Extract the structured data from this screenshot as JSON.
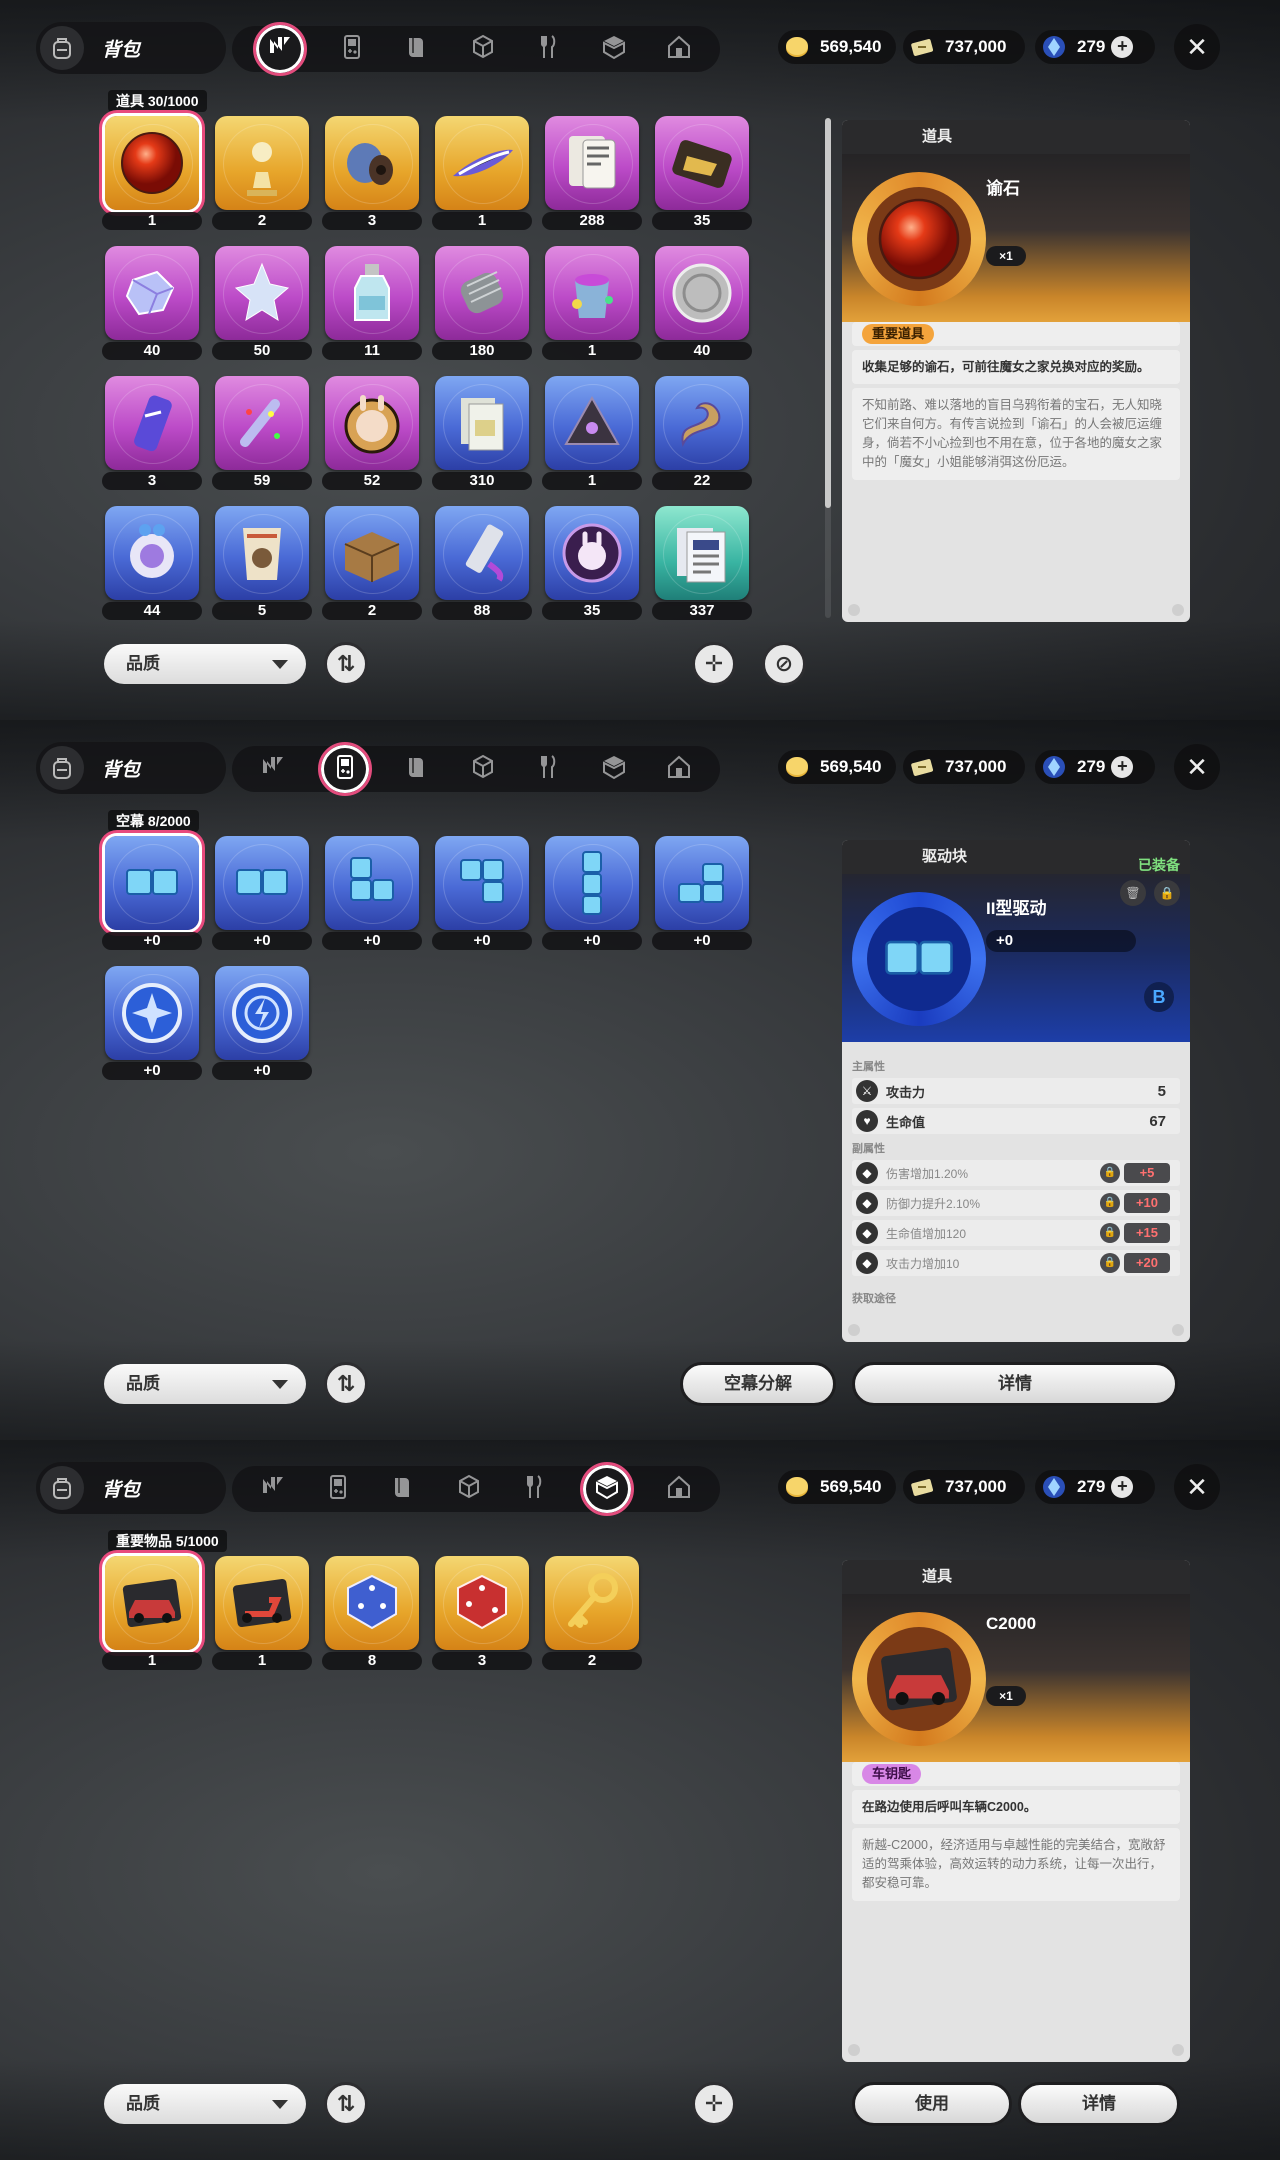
{
  "colors": {
    "accent": "#e84a7d",
    "gold_card": "#e7a52a",
    "purple_card": "#bc4bc8",
    "blue_card": "#4a6ad6",
    "teal_card": "#39b4a2"
  },
  "header": {
    "title": "背包",
    "tabs": [
      {
        "icon": "n-logo-icon"
      },
      {
        "icon": "gameboy-icon"
      },
      {
        "icon": "book-icon"
      },
      {
        "icon": "cube-icon"
      },
      {
        "icon": "fork-knife-icon"
      },
      {
        "icon": "gift-box-icon"
      },
      {
        "icon": "house-icon"
      }
    ],
    "currency": {
      "gold": "569,540",
      "ticket": "737,000",
      "gem": "279",
      "plus": "+"
    },
    "close": "✕"
  },
  "panels": [
    {
      "active_tab": 0,
      "category": "道具 30/1000",
      "items": [
        {
          "count": "1",
          "color": "gold",
          "icon": "red-orb-icon",
          "selected": true
        },
        {
          "count": "2",
          "color": "gold",
          "icon": "chess-piece-icon"
        },
        {
          "count": "3",
          "color": "gold",
          "icon": "wire-spool-icon"
        },
        {
          "count": "1",
          "color": "gold",
          "icon": "surfboard-icon"
        },
        {
          "count": "288",
          "color": "purple",
          "icon": "cards-icon"
        },
        {
          "count": "35",
          "color": "purple",
          "icon": "tray-icon"
        },
        {
          "count": "40",
          "color": "purple",
          "icon": "crystal-icon"
        },
        {
          "count": "50",
          "color": "purple",
          "icon": "ice-sculpture-icon"
        },
        {
          "count": "11",
          "color": "purple",
          "icon": "bottle-icon"
        },
        {
          "count": "180",
          "color": "purple",
          "icon": "coil-icon"
        },
        {
          "count": "1",
          "color": "purple",
          "icon": "paint-bucket-icon"
        },
        {
          "count": "40",
          "color": "purple",
          "icon": "silver-coin-icon"
        },
        {
          "count": "3",
          "color": "purple",
          "icon": "energy-can-icon"
        },
        {
          "count": "59",
          "color": "purple",
          "icon": "confetti-icon"
        },
        {
          "count": "52",
          "color": "purple",
          "icon": "bunny-badge-icon"
        },
        {
          "count": "310",
          "color": "blue",
          "icon": "document-icon"
        },
        {
          "count": "1",
          "color": "blue",
          "icon": "pyramid-icon"
        },
        {
          "count": "22",
          "color": "blue",
          "icon": "dragon-icon"
        },
        {
          "count": "44",
          "color": "blue",
          "icon": "orb-ring-icon"
        },
        {
          "count": "5",
          "color": "blue",
          "icon": "snack-bag-icon"
        },
        {
          "count": "2",
          "color": "blue",
          "icon": "crate-icon"
        },
        {
          "count": "88",
          "color": "blue",
          "icon": "tube-icon"
        },
        {
          "count": "35",
          "color": "blue",
          "icon": "bunny-coin-icon"
        },
        {
          "count": "337",
          "color": "teal",
          "icon": "newspaper-icon"
        }
      ],
      "detail": {
        "type_label": "道具",
        "name": "谕石",
        "qty": "×1",
        "tag": "重要道具",
        "desc": "收集足够的谕石，可前往魔女之家兑换对应的奖励。",
        "lore": "不知前路、难以落地的盲目乌鸦衔着的宝石，无人知晓它们来自何方。有传言说捡到「谕石」的人会被厄运缠身，倘若不小心捡到也不用在意，位于各地的魔女之家中的「魔女」小姐能够消弭这份厄运。"
      },
      "bottom": {
        "sort": "品质",
        "sort_icon": "⇅",
        "add_icon": "✛",
        "ban_icon": "⊘"
      }
    },
    {
      "active_tab": 1,
      "category": "空幕 8/2000",
      "items": [
        {
          "count": "+0",
          "color": "blue",
          "icon": "drive-block-2-icon",
          "selected": true
        },
        {
          "count": "+0",
          "color": "blue",
          "icon": "drive-block-2-icon"
        },
        {
          "count": "+0",
          "color": "blue",
          "icon": "drive-block-l-icon"
        },
        {
          "count": "+0",
          "color": "blue",
          "icon": "drive-block-j-icon"
        },
        {
          "count": "+0",
          "color": "blue",
          "icon": "drive-block-i-icon"
        },
        {
          "count": "+0",
          "color": "blue",
          "icon": "drive-block-s-icon"
        },
        {
          "count": "+0",
          "color": "blue",
          "icon": "compass-disc-icon"
        },
        {
          "count": "+0",
          "color": "blue",
          "icon": "lightning-disc-icon"
        }
      ],
      "detail": {
        "type_label": "驱动块",
        "equipped": "已装备",
        "name": "II型驱动",
        "level": "+0",
        "badge": "B",
        "main_title": "主属性",
        "main_stats": [
          {
            "name": "攻击力",
            "value": "5"
          },
          {
            "name": "生命值",
            "value": "67"
          }
        ],
        "sub_title": "副属性",
        "sub_stats": [
          {
            "name": "伤害增加1.20%",
            "plus": "+5"
          },
          {
            "name": "防御力提升2.10%",
            "plus": "+10"
          },
          {
            "name": "生命值增加120",
            "plus": "+15"
          },
          {
            "name": "攻击力增加10",
            "plus": "+20"
          }
        ],
        "source_title": "获取途径"
      },
      "bottom": {
        "sort": "品质",
        "sort_icon": "⇅",
        "decompose": "空幕分解",
        "details": "详情"
      }
    },
    {
      "active_tab": 5,
      "category": "重要物品 5/1000",
      "items": [
        {
          "count": "1",
          "color": "gold",
          "icon": "red-car-icon",
          "selected": true
        },
        {
          "count": "1",
          "color": "gold",
          "icon": "scooter-icon"
        },
        {
          "count": "8",
          "color": "gold",
          "icon": "blue-dice-icon"
        },
        {
          "count": "3",
          "color": "gold",
          "icon": "red-dice-icon"
        },
        {
          "count": "2",
          "color": "gold",
          "icon": "golden-key-icon"
        }
      ],
      "detail": {
        "type_label": "道具",
        "name": "C2000",
        "qty": "×1",
        "tag": "车钥匙",
        "desc": "在路边使用后呼叫车辆C2000。",
        "lore": "新越-C2000，经济适用与卓越性能的完美结合，宽敞舒适的驾乘体验，高效运转的动力系统，让每一次出行，都安稳可靠。"
      },
      "bottom": {
        "sort": "品质",
        "sort_icon": "⇅",
        "add_icon": "✛",
        "use": "使用",
        "details": "详情"
      }
    }
  ]
}
